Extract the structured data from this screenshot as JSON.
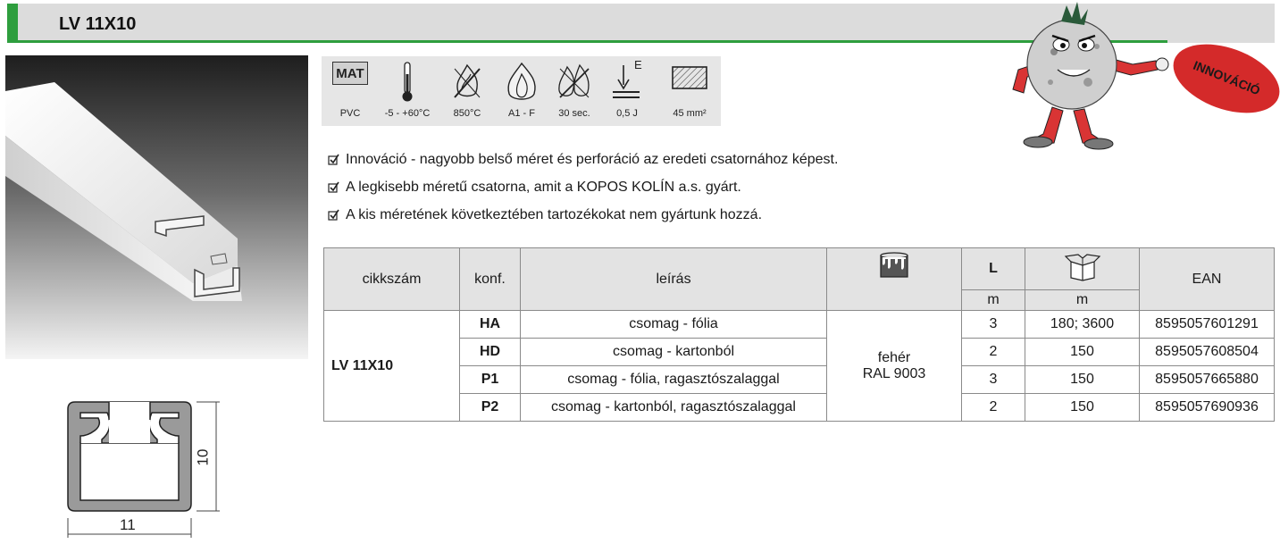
{
  "header": {
    "title": "LV 11X10"
  },
  "innovation_badge": "INNOVÁCIÓ",
  "properties": [
    {
      "icon": "mat-badge",
      "badge_text": "MAT",
      "value": "PVC"
    },
    {
      "icon": "thermometer-icon",
      "value": "-5 - +60°C"
    },
    {
      "icon": "glow-wire-icon",
      "value": "850°C"
    },
    {
      "icon": "flame-icon",
      "value": "A1 - F"
    },
    {
      "icon": "fire-time-icon",
      "value": "30 sec."
    },
    {
      "icon": "impact-icon",
      "value": "0,5 J",
      "icon_label": "E"
    },
    {
      "icon": "cross-section-icon",
      "value": "45 mm²"
    }
  ],
  "bullets": [
    "Innováció - nagyobb belső méret és perforáció az eredeti csatornához képest.",
    "A legkisebb méretű csatorna, amit a KOPOS KOLÍN a.s. gyárt.",
    "A kis méretének következtében tartozékokat nem gyártunk hozzá."
  ],
  "drawing": {
    "width_label": "11",
    "height_label": "10"
  },
  "table": {
    "headers": {
      "code": "cikkszám",
      "conf": "konf.",
      "desc": "leírás",
      "length": "L",
      "length_unit": "m",
      "package_unit": "m",
      "ean": "EAN"
    },
    "product_code": "LV 11X10",
    "color_line1": "fehér",
    "color_line2": "RAL 9003",
    "rows": [
      {
        "conf": "HA",
        "desc": "csomag - fólia",
        "length": "3",
        "package": "180; 3600",
        "ean": "8595057601291"
      },
      {
        "conf": "HD",
        "desc": "csomag - kartonból",
        "length": "2",
        "package": "150",
        "ean": "8595057608504"
      },
      {
        "conf": "P1",
        "desc": "csomag - fólia, ragasztószalaggal",
        "length": "3",
        "package": "150",
        "ean": "8595057665880"
      },
      {
        "conf": "P2",
        "desc": "csomag - kartonból, ragasztószalaggal",
        "length": "2",
        "package": "150",
        "ean": "8595057690936"
      }
    ]
  }
}
